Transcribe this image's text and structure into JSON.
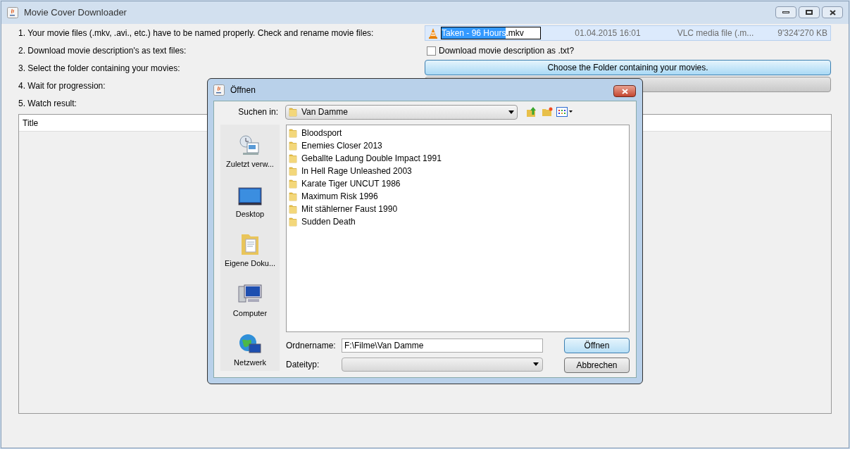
{
  "window": {
    "title": "Movie Cover Downloader"
  },
  "steps": [
    "1. Your movie files (.mkv, .avi., etc.) have to be named properly. Check and rename movie files:",
    "2. Download movie description's as text files:",
    "3. Select the folder containing your movies:",
    "4. Wait for progression:",
    "5. Watch result:"
  ],
  "file_row": {
    "name_selected": "Taken - 96 Hours",
    "name_rest": ".mkv",
    "date": "01.04.2015 16:01",
    "type": "VLC media file (.m...",
    "size": "9'324'270 KB"
  },
  "download_checkbox": {
    "label": "Download movie description as .txt?",
    "checked": false
  },
  "choose_button": "Choose the Folder containing your movies.",
  "progress": {
    "level": 0
  },
  "table": {
    "columns": [
      "Title"
    ]
  },
  "dialog": {
    "title": "Öffnen",
    "look_in_label": "Suchen in:",
    "look_in_value": "Van Damme",
    "places": [
      {
        "kind": "recent",
        "label": "Zuletzt verw..."
      },
      {
        "kind": "desktop",
        "label": "Desktop"
      },
      {
        "kind": "documents",
        "label": "Eigene Doku..."
      },
      {
        "kind": "computer",
        "label": "Computer"
      },
      {
        "kind": "network",
        "label": "Netzwerk"
      }
    ],
    "folders": [
      "Bloodsport",
      "Enemies Closer 2013",
      "Geballte Ladung Double Impact 1991",
      "In Hell Rage Unleashed 2003",
      "Karate Tiger UNCUT 1986",
      "Maximum Risk 1996",
      "Mit stählerner Faust 1990",
      "Sudden Death"
    ],
    "folder_name_label": "Ordnername:",
    "folder_name_value": "F:\\Filme\\Van Damme",
    "file_type_label": "Dateityp:",
    "buttons": [
      "Öffnen",
      "Abbrechen"
    ]
  }
}
